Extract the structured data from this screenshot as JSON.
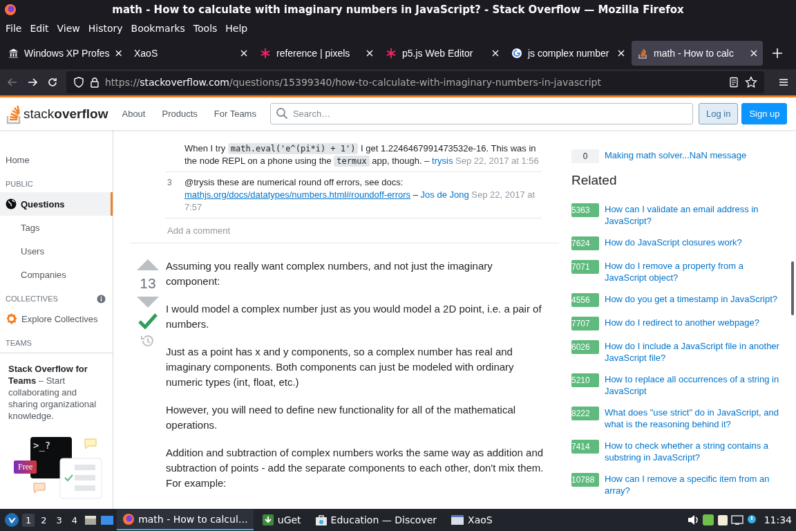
{
  "window": {
    "title": "math - How to calculate with imaginary numbers in JavaScript? - Stack Overflow — Mozilla Firefox"
  },
  "menu": [
    "File",
    "Edit",
    "View",
    "History",
    "Bookmarks",
    "Tools",
    "Help"
  ],
  "tabs": [
    {
      "label": "Windows XP Profes",
      "selected": false
    },
    {
      "label": "XaoS",
      "selected": false
    },
    {
      "label": "reference | pixels",
      "selected": false
    },
    {
      "label": "p5.js Web Editor",
      "selected": false
    },
    {
      "label": "js complex number",
      "selected": false
    },
    {
      "label": "math - How to calc",
      "selected": true
    }
  ],
  "url": {
    "scheme": "https://",
    "host": "stackoverflow.com",
    "path": "/questions/15399340/how-to-calculate-with-imaginary-numbers-in-javascript"
  },
  "so_header": {
    "logo_light": "stack",
    "logo_bold": "overflow",
    "nav": [
      "About",
      "Products",
      "For Teams"
    ],
    "search": {
      "placeholder": "Search…"
    },
    "login": "Log in",
    "signup": "Sign up"
  },
  "sidebar": {
    "items": [
      {
        "label": "Home",
        "kind": "top",
        "selected": false
      },
      {
        "label": "PUBLIC",
        "kind": "heading",
        "selected": false
      },
      {
        "label": "Questions",
        "kind": "main",
        "selected": true
      },
      {
        "label": "Tags",
        "kind": "sub",
        "selected": false
      },
      {
        "label": "Users",
        "kind": "sub",
        "selected": false
      },
      {
        "label": "Companies",
        "kind": "sub",
        "selected": false
      },
      {
        "label": "COLLECTIVES",
        "kind": "heading-info",
        "selected": false
      },
      {
        "label": "Explore Collectives",
        "kind": "collectives",
        "selected": false
      },
      {
        "label": "TEAMS",
        "kind": "heading",
        "selected": false
      }
    ],
    "teams_promo": {
      "text": "**Stack Overflow for Teams** – Start collaborating and sharing organizational knowledge.",
      "terminal": ">_?",
      "badge": "Free"
    }
  },
  "comments": [
    {
      "body": [
        {
          "kind": "text",
          "text": "When I try "
        },
        {
          "kind": "code",
          "text": "math.eval('e^(pi*i) + 1')"
        },
        {
          "kind": "text",
          "text": " I get 1.2246467991473532e-16. This was in the node REPL on a phone using the "
        },
        {
          "kind": "code",
          "text": "termux"
        },
        {
          "kind": "text",
          "text": " app, though. –"
        }
      ],
      "user": "trysis",
      "date": "Sep 22, 2017 at 1:56"
    },
    {
      "score": "3",
      "body": [
        {
          "kind": "text",
          "text": "@trysis these are numerical round off errors, see docs: "
        },
        {
          "kind": "link",
          "text": "mathjs.org/docs/datatypes"
        },
        {
          "kind": "link",
          "text": "/numbers.html#roundoff-errors"
        },
        {
          "kind": "text",
          "text": " –"
        }
      ],
      "user": "Jos de Jong",
      "date": "Sep 22, 2017 at 7:57"
    }
  ],
  "add_comment": "Add a comment",
  "answer": {
    "score": "13",
    "accepted": true,
    "paragraphs": [
      "Assuming you really want complex numbers, and not just the imaginary component:",
      "I would model a complex number just as you would model a 2D point, i.e. a pair of numbers.",
      "Just as a point has x and y components, so a complex number has real and imaginary components. Both components can just be modeled with ordinary numeric types (int, float, etc.)",
      "However, you will need to define new functionality for all of the mathematical operations.",
      "Addition and subtraction of complex numbers works the same way as addition and subtraction of points - add the separate components to each other, don't mix them. For example:"
    ]
  },
  "linked": [
    {
      "score": "0",
      "title": "Making math solver...NaN message"
    }
  ],
  "related": {
    "title": "Related",
    "items": [
      {
        "score": "5363",
        "title": "How can I validate an email address in JavaScript?"
      },
      {
        "score": "7624",
        "title": "How do JavaScript closures work?"
      },
      {
        "score": "7071",
        "title": "How do I remove a property from a JavaScript object?"
      },
      {
        "score": "4556",
        "title": "How do you get a timestamp in JavaScript?"
      },
      {
        "score": "7707",
        "title": "How do I redirect to another webpage?"
      },
      {
        "score": "6026",
        "title": "How do I include a JavaScript file in another JavaScript file?"
      },
      {
        "score": "5210",
        "title": "How to replace all occurrences of a string in JavaScript"
      },
      {
        "score": "8222",
        "title": "What does \"use strict\" do in JavaScript, and what is the reasoning behind it?"
      },
      {
        "score": "7414",
        "title": "How to check whether a string contains a substring in JavaScript?"
      },
      {
        "score": "10788",
        "title": "How can I remove a specific item from an array?"
      }
    ]
  },
  "taskbar": {
    "workspaces": [
      {
        "label": "1",
        "selected": true
      },
      {
        "label": "2",
        "selected": false
      },
      {
        "label": "3",
        "selected": false
      },
      {
        "label": "4",
        "selected": false
      }
    ],
    "apps": [
      {
        "label": "math - How to calcul…",
        "selected": true
      },
      {
        "label": "uGet",
        "selected": false
      },
      {
        "label": "Education — Discover",
        "selected": false
      },
      {
        "label": "XaoS",
        "selected": false
      }
    ],
    "clock": "11:34"
  }
}
